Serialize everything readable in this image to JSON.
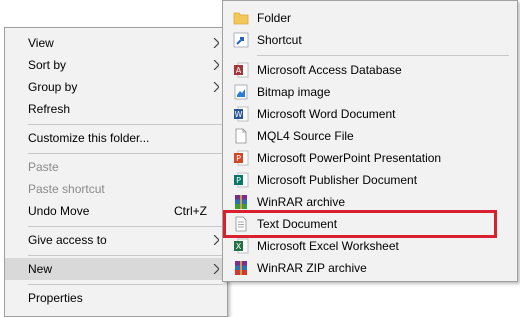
{
  "main_menu": {
    "items": [
      {
        "label": "View",
        "has_submenu": true
      },
      {
        "label": "Sort by",
        "has_submenu": true
      },
      {
        "label": "Group by",
        "has_submenu": true
      },
      {
        "label": "Refresh"
      },
      {
        "label": "Customize this folder..."
      },
      {
        "label": "Paste",
        "disabled": true
      },
      {
        "label": "Paste shortcut",
        "disabled": true
      },
      {
        "label": "Undo Move",
        "shortcut": "Ctrl+Z"
      },
      {
        "label": "Give access to",
        "has_submenu": true
      },
      {
        "label": "New",
        "has_submenu": true,
        "active": true
      },
      {
        "label": "Properties"
      }
    ]
  },
  "new_submenu": {
    "items": [
      {
        "label": "Folder",
        "icon": "folder-icon"
      },
      {
        "label": "Shortcut",
        "icon": "shortcut-icon"
      },
      {
        "label": "Microsoft Access Database",
        "icon": "access-icon"
      },
      {
        "label": "Bitmap image",
        "icon": "bitmap-icon"
      },
      {
        "label": "Microsoft Word Document",
        "icon": "word-icon"
      },
      {
        "label": "MQL4 Source File",
        "icon": "blank-file-icon"
      },
      {
        "label": "Microsoft PowerPoint Presentation",
        "icon": "powerpoint-icon"
      },
      {
        "label": "Microsoft Publisher Document",
        "icon": "publisher-icon"
      },
      {
        "label": "WinRAR archive",
        "icon": "winrar-icon"
      },
      {
        "label": "Text Document",
        "icon": "text-document-icon",
        "highlighted": true
      },
      {
        "label": "Microsoft Excel Worksheet",
        "icon": "excel-icon"
      },
      {
        "label": "WinRAR ZIP archive",
        "icon": "winrar-zip-icon"
      }
    ]
  },
  "colors": {
    "menu_bg": "#f2f2f2",
    "highlight_border": "#d9202e",
    "disabled_text": "#8a8a8a"
  }
}
